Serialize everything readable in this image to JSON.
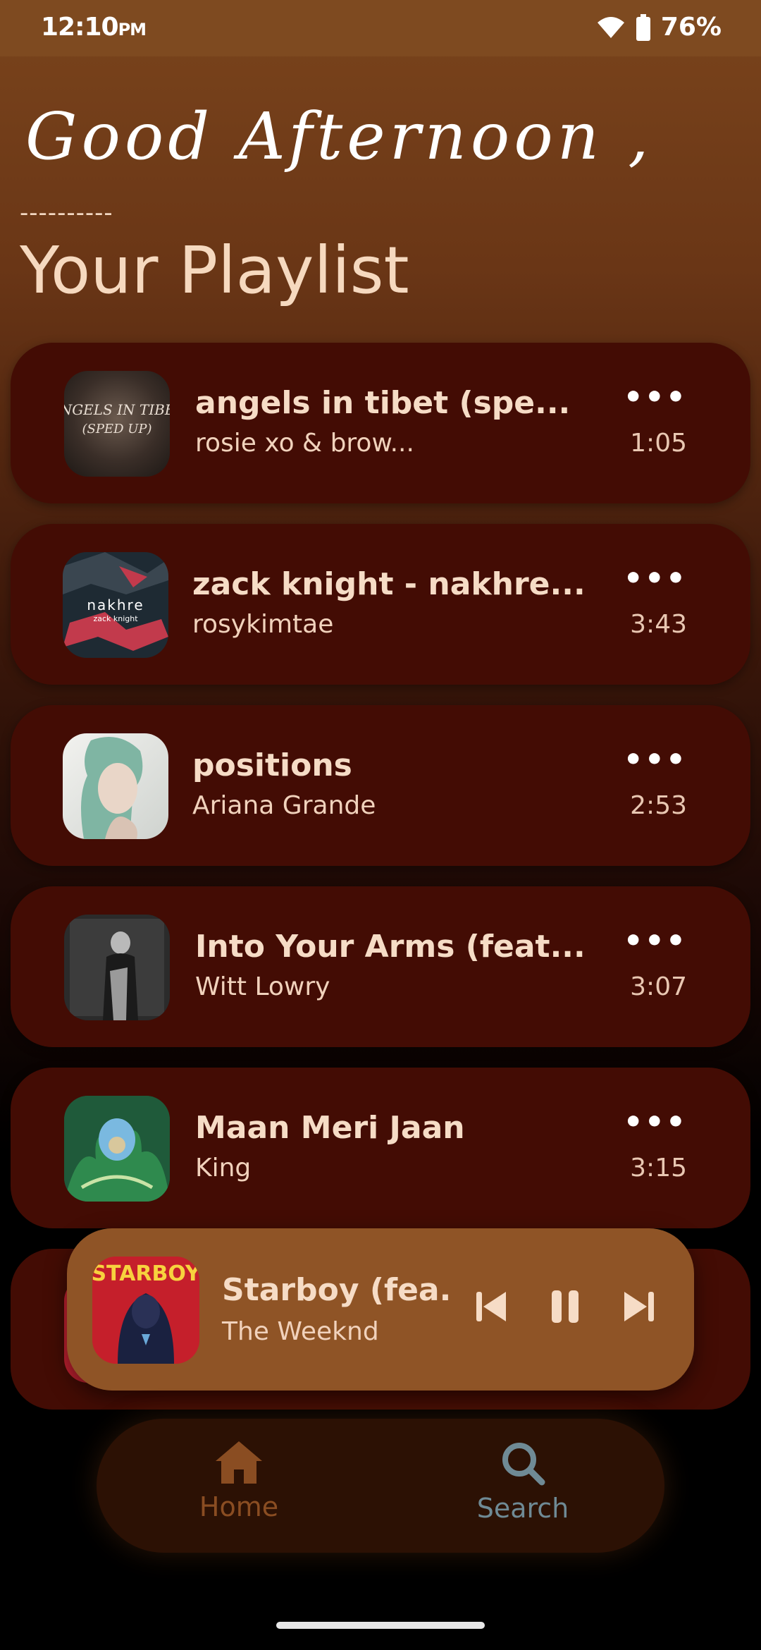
{
  "status": {
    "time": "12:10",
    "ampm": "PM",
    "battery": "76%"
  },
  "greeting": "Good Afternoon ,",
  "divider": "----------",
  "title": "Your Playlist",
  "songs": [
    {
      "title": "angels in tibet (spe...",
      "artist": "rosie xo & brow...",
      "duration": "1:05",
      "more": "•••"
    },
    {
      "title": "zack knight - nakhre...",
      "artist": "rosykimtae",
      "duration": "3:43",
      "more": "•••",
      "cover_text1": "nakhre",
      "cover_text2": "zack knight"
    },
    {
      "title": "positions",
      "artist": "Ariana Grande",
      "duration": "2:53",
      "more": "•••"
    },
    {
      "title": "Into Your Arms (feat...",
      "artist": "Witt Lowry",
      "duration": "3:07",
      "more": "•••"
    },
    {
      "title": "Maan Meri Jaan",
      "artist": "King",
      "duration": "3:15",
      "more": "•••"
    }
  ],
  "now_playing": {
    "title": "Starboy (fea.",
    "artist": "The Weeknd",
    "cover_text": "STARBOY"
  },
  "nav": {
    "home": "Home",
    "search": "Search"
  },
  "colors": {
    "card": "#430c04",
    "mini_player": "#8f5426",
    "nav_home": "#8a4d22",
    "nav_search": "#6f8a95"
  }
}
